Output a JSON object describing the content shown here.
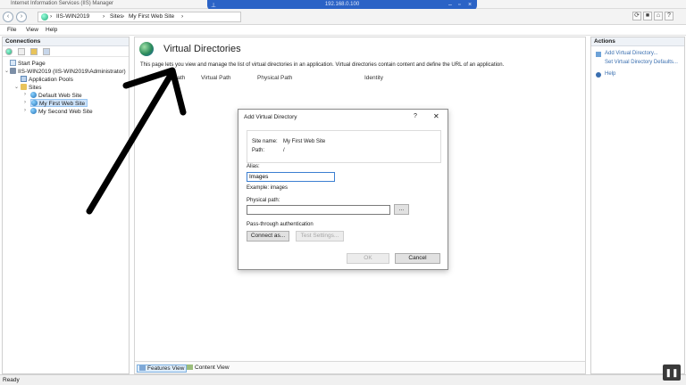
{
  "window": {
    "title": "Internet Information Services (IIS) Manager"
  },
  "remote": {
    "ip": "192.168.0.100"
  },
  "breadcrumb": [
    "IIS-WIN2019",
    "Sites",
    "My First Web Site"
  ],
  "menu": [
    "File",
    "View",
    "Help"
  ],
  "connections": {
    "header": "Connections",
    "tree": {
      "start_page": "Start Page",
      "server": "IIS-WIN2019 (IIS-WIN2019\\Administrator)",
      "app_pools": "Application Pools",
      "sites": "Sites",
      "site1": "Default Web Site",
      "site2": "My First Web Site",
      "site3": "My Second Web Site"
    }
  },
  "content": {
    "title": "Virtual Directories",
    "description": "This page lets you view and manage the list of virtual directories in an application. Virtual directories contain content and define the URL of an application.",
    "columns": [
      "Path",
      "Virtual Path",
      "Physical Path",
      "Identity"
    ],
    "features_view": "Features View",
    "content_view": "Content View"
  },
  "actions": {
    "header": "Actions",
    "add_vdir": "Add Virtual Directory...",
    "set_defaults": "Set Virtual Directory Defaults...",
    "help": "Help"
  },
  "dialog": {
    "title": "Add Virtual Directory",
    "help_glyph": "?",
    "close_glyph": "✕",
    "site_name_label": "Site name:",
    "site_name_value": "My First Web Site",
    "path_label": "Path:",
    "path_value": "/",
    "alias_label": "Alias:",
    "alias_value": "Images",
    "alias_example": "Example: images",
    "physical_path_label": "Physical path:",
    "physical_path_value": "",
    "browse_label": "...",
    "passthrough_label": "Pass-through authentication",
    "connect_as_label": "Connect as...",
    "test_settings_label": "Test Settings...",
    "ok_label": "OK",
    "cancel_label": "Cancel"
  },
  "statusbar": {
    "text": "Ready"
  },
  "colors": {
    "accent": "#2b63c6",
    "link": "#3a6fb0",
    "selection": "#cde3fa",
    "annotation_arrow": "#000000"
  }
}
